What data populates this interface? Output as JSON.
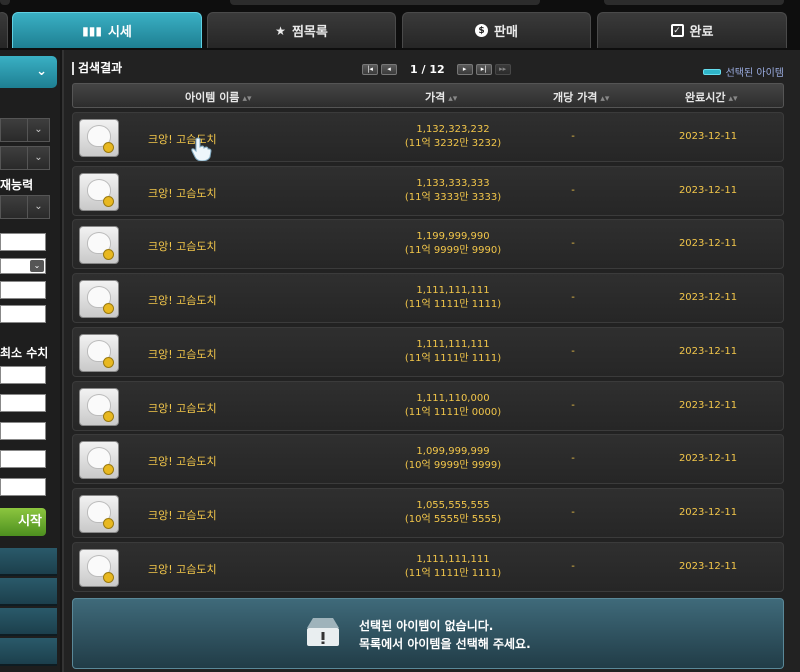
{
  "tabs": [
    {
      "label": "시세",
      "icon": "chart-bar-icon",
      "active": true
    },
    {
      "label": "찜목록",
      "icon": "star-icon",
      "active": false
    },
    {
      "label": "판매",
      "icon": "dollar-coin-icon",
      "active": false
    },
    {
      "label": "완료",
      "icon": "checkbox-icon",
      "active": false
    }
  ],
  "left": {
    "label_ability": "재능력",
    "label_min": "최소 수치",
    "start_button": "시작"
  },
  "toolbar": {
    "title": "검색결과",
    "page_current": "1",
    "page_total": "12",
    "page_sep": "/",
    "legend_label": "선택된 아이템"
  },
  "table": {
    "headers": {
      "name": "아이템 이름",
      "price": "가격",
      "unit_price": "개당 가격",
      "completed": "완료시간"
    },
    "rows": [
      {
        "name": "크앙! 고슴도치",
        "price": "1,132,323,232",
        "price_kr": "(11억 3232만 3232)",
        "unit": "-",
        "date": "2023-12-11"
      },
      {
        "name": "크앙! 고슴도치",
        "price": "1,133,333,333",
        "price_kr": "(11억 3333만 3333)",
        "unit": "-",
        "date": "2023-12-11"
      },
      {
        "name": "크앙! 고슴도치",
        "price": "1,199,999,990",
        "price_kr": "(11억 9999만 9990)",
        "unit": "-",
        "date": "2023-12-11"
      },
      {
        "name": "크앙! 고슴도치",
        "price": "1,111,111,111",
        "price_kr": "(11억 1111만 1111)",
        "unit": "-",
        "date": "2023-12-11"
      },
      {
        "name": "크앙! 고슴도치",
        "price": "1,111,111,111",
        "price_kr": "(11억 1111만 1111)",
        "unit": "-",
        "date": "2023-12-11"
      },
      {
        "name": "크앙! 고슴도치",
        "price": "1,111,110,000",
        "price_kr": "(11억 1111만 0000)",
        "unit": "-",
        "date": "2023-12-11"
      },
      {
        "name": "크앙! 고슴도치",
        "price": "1,099,999,999",
        "price_kr": "(10억 9999만 9999)",
        "unit": "-",
        "date": "2023-12-11"
      },
      {
        "name": "크앙! 고슴도치",
        "price": "1,055,555,555",
        "price_kr": "(10억 5555만 5555)",
        "unit": "-",
        "date": "2023-12-11"
      },
      {
        "name": "크앙! 고슴도치",
        "price": "1,111,111,111",
        "price_kr": "(11억 1111만 1111)",
        "unit": "-",
        "date": "2023-12-11"
      }
    ]
  },
  "info": {
    "line1": "선택된 아이템이 없습니다.",
    "line2": "목록에서 아이템을 선택해 주세요."
  },
  "colors": {
    "accent": "#2fb5c9",
    "price_text": "#f2c64a",
    "start_button": "#6aab2e"
  }
}
